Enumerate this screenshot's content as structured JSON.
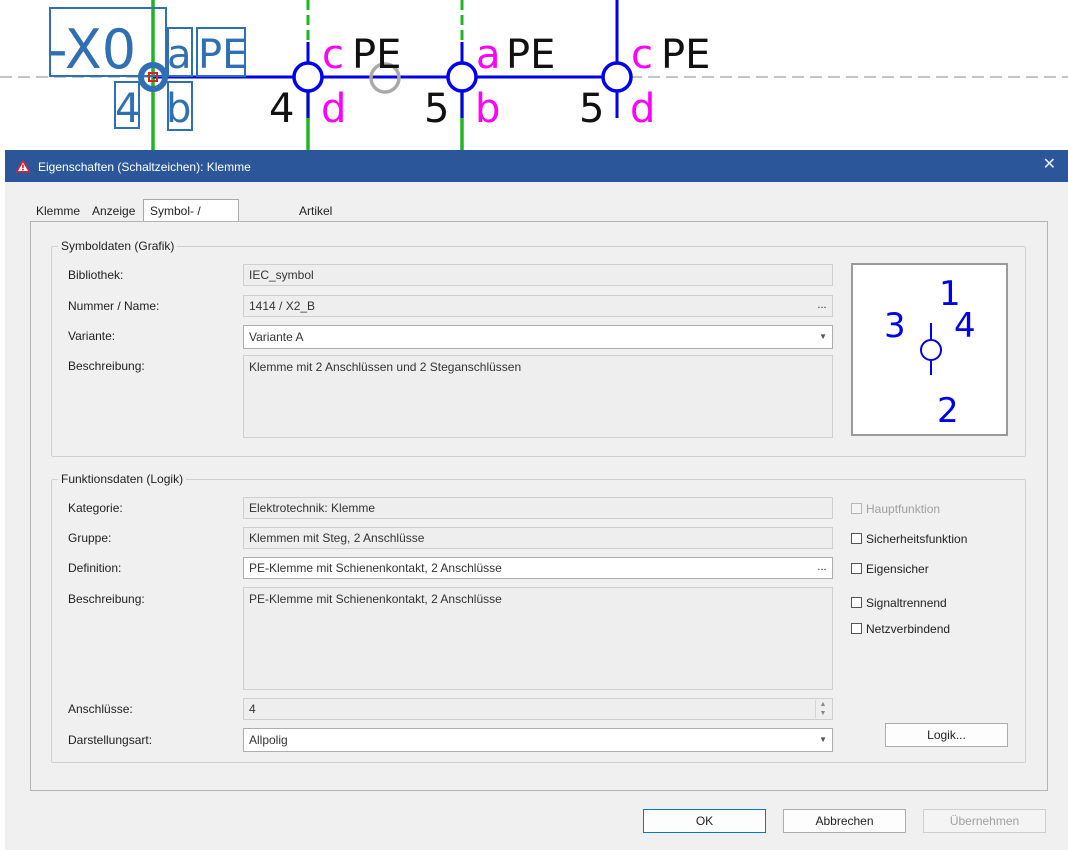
{
  "schematic": {
    "device_tag": "-X0",
    "terminals": [
      {
        "num": "4",
        "top": "a",
        "bottom": "b",
        "type": "PE"
      },
      {
        "num": "4",
        "top": "c",
        "bottom": "d",
        "type": "PE"
      },
      {
        "num": "5",
        "top": "a",
        "bottom": "b",
        "type": "PE"
      },
      {
        "num": "5",
        "top": "c",
        "bottom": "d",
        "type": "PE"
      }
    ],
    "colors": {
      "wire": "#0000ee",
      "pe_wire": "#22b522",
      "letter": "#ff00ff",
      "selected": "#2f6fb3"
    }
  },
  "dialog": {
    "title": "Eigenschaften (Schaltzeichen): Klemme",
    "close_icon": "close-icon",
    "tabs": [
      "Klemme",
      "Anzeige",
      "Symbol- / Funktionsdaten",
      "Artikel"
    ],
    "active_tab": "Symbol- / Funktionsdaten",
    "symbol_group": {
      "legend": "Symboldaten (Grafik)",
      "bibliothek_label": "Bibliothek:",
      "bibliothek_value": "IEC_symbol",
      "nummer_label": "Nummer / Name:",
      "nummer_value": "1414 / X2_B",
      "variante_label": "Variante:",
      "variante_value": "Variante A",
      "beschreibung_label": "Beschreibung:",
      "beschreibung_value": "Klemme mit 2 Anschlüssen und 2 Steganschlüssen",
      "preview_numbers": {
        "top": "1",
        "bottom": "2",
        "left": "3",
        "right": "4"
      }
    },
    "function_group": {
      "legend": "Funktionsdaten (Logik)",
      "kategorie_label": "Kategorie:",
      "kategorie_value": "Elektrotechnik: Klemme",
      "gruppe_label": "Gruppe:",
      "gruppe_value": "Klemmen mit Steg, 2 Anschlüsse",
      "definition_label": "Definition:",
      "definition_value": "PE-Klemme mit Schienenkontakt, 2 Anschlüsse",
      "beschreibung_label": "Beschreibung:",
      "beschreibung_value": "PE-Klemme mit Schienenkontakt, 2 Anschlüsse",
      "anschluesse_label": "Anschlüsse:",
      "anschluesse_value": "4",
      "darstellung_label": "Darstellungsart:",
      "darstellung_value": "Allpolig",
      "checkboxes": {
        "hauptfunktion": "Hauptfunktion",
        "sicherheit": "Sicherheitsfunktion",
        "eigensicher": "Eigensicher",
        "signaltrennend": "Signaltrennend",
        "netzverbindend": "Netzverbindend"
      },
      "logik_button": "Logik..."
    },
    "ellipsis": "...",
    "buttons": {
      "ok": "OK",
      "cancel": "Abbrechen",
      "apply": "Übernehmen"
    }
  }
}
